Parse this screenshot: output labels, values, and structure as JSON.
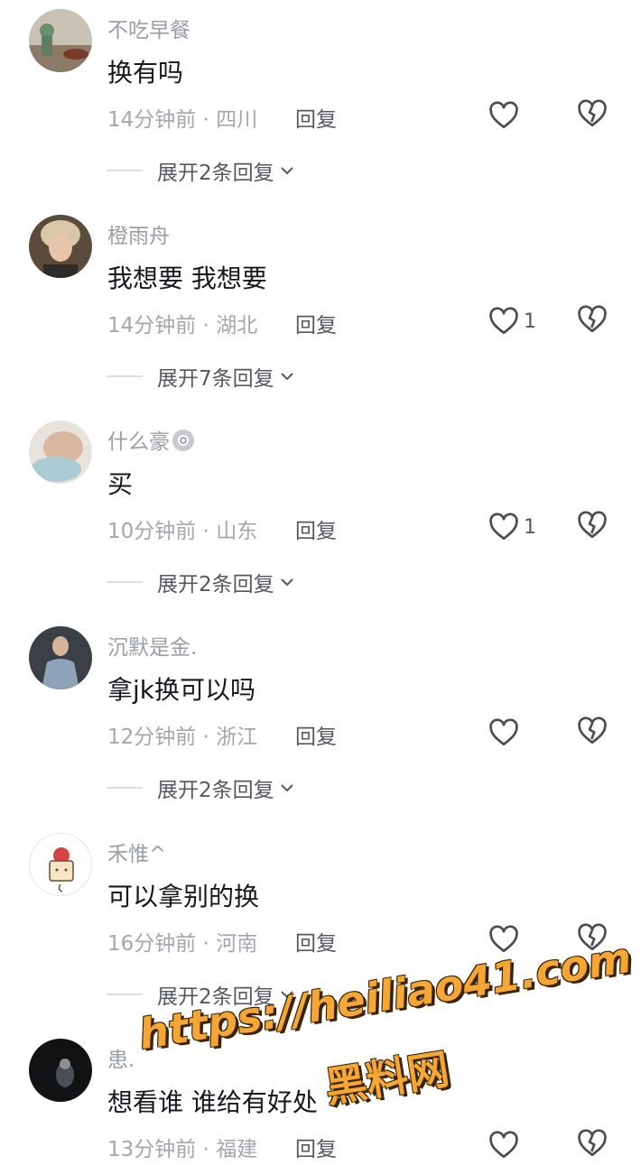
{
  "comments": [
    {
      "user": "不吃早餐",
      "text": "换有吗",
      "time": "14分钟前",
      "location": "四川",
      "reply": "回复",
      "likes": "",
      "expand": "展开2条回复"
    },
    {
      "user": "橙雨舟",
      "text": "我想要 我想要",
      "time": "14分钟前",
      "location": "湖北",
      "reply": "回复",
      "likes": "1",
      "expand": "展开7条回复"
    },
    {
      "user": "什么豪",
      "text": "买",
      "time": "10分钟前",
      "location": "山东",
      "reply": "回复",
      "likes": "1",
      "expand": "展开2条回复"
    },
    {
      "user": "沉默是金.",
      "text": "拿jk换可以吗",
      "time": "12分钟前",
      "location": "浙江",
      "reply": "回复",
      "likes": "",
      "expand": "展开2条回复"
    },
    {
      "user": "禾惟^",
      "text": "可以拿别的换",
      "time": "16分钟前",
      "location": "河南",
      "reply": "回复",
      "likes": "",
      "expand": "展开2条回复"
    },
    {
      "user": "患.",
      "text": "想看谁 谁给有好处",
      "time": "13分钟前",
      "location": "福建",
      "reply": "回复",
      "likes": "",
      "expand": ""
    }
  ],
  "meta_separator": " · ",
  "watermark": {
    "url": "https://heiliao41.com",
    "name": "黑料网"
  },
  "colors": {
    "username": "#9a9ea6",
    "text": "#16181d",
    "meta": "#a4a7ad",
    "action": "#55585e",
    "watermark": "#f4a734"
  }
}
